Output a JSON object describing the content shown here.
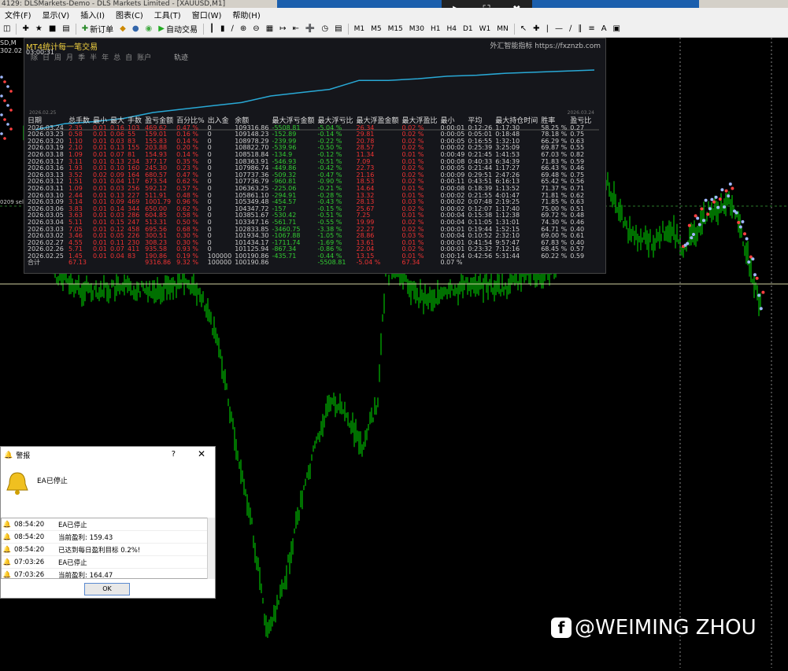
{
  "window": {
    "title": "4129: DLSMarkets-Demo - DLS Markets Limited - [XAUUSD,M1]"
  },
  "remote_control": {
    "icons": [
      "play-icon",
      "fullscreen-icon",
      "close-icon"
    ]
  },
  "menu": {
    "items": [
      "文件(F)",
      "显示(V)",
      "插入(I)",
      "图表(C)",
      "工具(T)",
      "窗口(W)",
      "帮助(H)"
    ]
  },
  "toolbar": {
    "new_order_label": "新订单",
    "auto_trade_label": "自动交易",
    "timeframes": [
      "M1",
      "M5",
      "M15",
      "M30",
      "H1",
      "H4",
      "D1",
      "W1",
      "MN"
    ]
  },
  "chart": {
    "symbol_label": "SD,M",
    "symbol_price": "302.02",
    "price_line_label": "0209 sell",
    "colors": {
      "candle": "#00e000",
      "background": "#000000",
      "price_line": "#d0d0a0"
    }
  },
  "panel": {
    "title": "MT4统计每一笔交易",
    "time": "03:00:31",
    "site": "外汇智能指标 https://fxznzb.com",
    "tabs": [
      "除",
      "日",
      "周",
      "月",
      "季",
      "半",
      "年",
      "总",
      "自",
      "账户"
    ],
    "curve_label": "轨迹",
    "curve_start_date": "2026.02.25",
    "curve_end_date": "2026.03.24",
    "headers": [
      "日期",
      "总手数",
      "最小",
      "最大",
      "手数",
      "盈亏金额",
      "百分比%",
      "出入金",
      "余额",
      "最大浮亏金额",
      "最大浮亏比",
      "最大浮盈金额",
      "最大浮盈比",
      "最小",
      "平均",
      "最大持仓时间",
      "胜率",
      "盈亏比"
    ],
    "rows": [
      [
        "2026.03.24",
        "2.35",
        "0.01",
        "0.16",
        "103",
        "469.62",
        "0.47 %",
        "0",
        "109316.86",
        "-5508.81",
        "-5.04 %",
        "26.34",
        "0.02 %",
        "0:00:01",
        "0:12:26",
        "1:17:30",
        "58.25 %",
        "0.27"
      ],
      [
        "2026.03.23",
        "0.58",
        "0.01",
        "0.06",
        "55",
        "159.01",
        "0.16 %",
        "0",
        "109148.23",
        "-152.89",
        "-0.14 %",
        "29.81",
        "0.02 %",
        "0:00:05",
        "0:05:01",
        "0:18:48",
        "78.18 %",
        "0.75"
      ],
      [
        "2026.03.20",
        "1.10",
        "0.01",
        "0.03",
        "83",
        "155.83",
        "0.14 %",
        "0",
        "108978.29",
        "-239.99",
        "-0.22 %",
        "20.78",
        "0.02 %",
        "0:00:05",
        "0:16:55",
        "1:32:10",
        "66.29 %",
        "0.63"
      ],
      [
        "2026.03.19",
        "2.10",
        "0.01",
        "0.13",
        "155",
        "203.88",
        "0.20 %",
        "0",
        "108822.70",
        "-539.96",
        "-0.50 %",
        "28.57",
        "0.02 %",
        "0:00:02",
        "0:25:39",
        "3:25:09",
        "69.87 %",
        "0.55"
      ],
      [
        "2026.03.18",
        "1.09",
        "0.01",
        "0.07",
        "81",
        "154.93",
        "0.14 %",
        "0",
        "108518.84",
        "-134.9",
        "-0.12 %",
        "11.34",
        "0.01 %",
        "0:00:49",
        "0:21:45",
        "1:41:53",
        "67.03 %",
        "0.82"
      ],
      [
        "2026.03.17",
        "3.11",
        "0.01",
        "0.13",
        "234",
        "377.17",
        "0.35 %",
        "0",
        "108363.91",
        "-546.93",
        "-0.51 %",
        "7.09",
        "0.01 %",
        "0:00:08",
        "0:40:33",
        "6:34:39",
        "71.83 %",
        "0.59"
      ],
      [
        "2026.03.16",
        "1.93",
        "0.01",
        "0.10",
        "160",
        "245.30",
        "0.23 %",
        "0",
        "107986.74",
        "-449.86",
        "-0.42 %",
        "22.73",
        "0.02 %",
        "0:00:05",
        "0:21:44",
        "1:17:27",
        "66.43 %",
        "0.46"
      ],
      [
        "2026.03.13",
        "3.52",
        "0.02",
        "0.09",
        "164",
        "680.57",
        "0.47 %",
        "0",
        "107737.36",
        "-509.32",
        "-0.47 %",
        "21.16",
        "0.02 %",
        "0:00:09",
        "0:29:51",
        "2:47:26",
        "69.48 %",
        "0.75"
      ],
      [
        "2026.03.12",
        "1.51",
        "0.01",
        "0.04",
        "117",
        "673.54",
        "0.62 %",
        "0",
        "107736.79",
        "-960.81",
        "-0.90 %",
        "18.53",
        "0.02 %",
        "0:00:11",
        "0:43:51",
        "6:16:13",
        "65.42 %",
        "0.56"
      ],
      [
        "2026.03.11",
        "1.09",
        "0.01",
        "0.03",
        "256",
        "592.12",
        "0.57 %",
        "0",
        "106363.25",
        "-225.06",
        "-0.21 %",
        "14.64",
        "0.01 %",
        "0:00:08",
        "0:18:39",
        "1:13:52",
        "71.37 %",
        "0.71"
      ],
      [
        "2026.03.10",
        "2.44",
        "0.01",
        "0.13",
        "227",
        "511.91",
        "0.48 %",
        "0",
        "105861.10",
        "-294.91",
        "-0.28 %",
        "13.32",
        "0.01 %",
        "0:00:02",
        "0:21:55",
        "4:01:47",
        "71.81 %",
        "0.62"
      ],
      [
        "2026.03.09",
        "3.14",
        "0.01",
        "0.09",
        "469",
        "1001.79",
        "0.96 %",
        "0",
        "105349.48",
        "-454.57",
        "-0.43 %",
        "28.13",
        "0.03 %",
        "0:00:02",
        "0:07:48",
        "2:19:25",
        "71.85 %",
        "0.63"
      ],
      [
        "2026.03.06",
        "3.83",
        "0.01",
        "0.14",
        "344",
        "650.00",
        "0.62 %",
        "0",
        "104347.72",
        "-157",
        "-0.15 %",
        "25.67",
        "0.02 %",
        "0:00:02",
        "0:12:07",
        "1:17:40",
        "75.00 %",
        "0.51"
      ],
      [
        "2026.03.05",
        "3.63",
        "0.01",
        "0.03",
        "286",
        "604.85",
        "0.58 %",
        "0",
        "103851.67",
        "-530.42",
        "-0.51 %",
        "7.25",
        "0.01 %",
        "0:00:04",
        "0:15:38",
        "1:12:38",
        "69.72 %",
        "0.48"
      ],
      [
        "2026.03.04",
        "5.11",
        "0.01",
        "0.15",
        "247",
        "513.31",
        "0.50 %",
        "0",
        "103347.16",
        "-561.71",
        "-0.55 %",
        "19.99",
        "0.02 %",
        "0:00:04",
        "0:11:05",
        "1:31:01",
        "74.30 %",
        "0.46"
      ],
      [
        "2026.03.03",
        "7.05",
        "0.01",
        "0.12",
        "458",
        "695.56",
        "0.68 %",
        "0",
        "102833.85",
        "-3460.75",
        "-3.38 %",
        "22.27",
        "0.02 %",
        "0:00:01",
        "0:19:44",
        "1:52:15",
        "64.71 %",
        "0.40"
      ],
      [
        "2026.03.02",
        "3.46",
        "0.01",
        "0.05",
        "226",
        "300.51",
        "0.30 %",
        "0",
        "101934.30",
        "-1067.88",
        "-1.05 %",
        "28.86",
        "0.03 %",
        "0:00:04",
        "0:10:52",
        "2:32:10",
        "69.00 %",
        "0.61"
      ],
      [
        "2026.02.27",
        "4.55",
        "0.01",
        "0.11",
        "230",
        "308.23",
        "0.30 %",
        "0",
        "101434.17",
        "-1711.74",
        "-1.69 %",
        "13.61",
        "0.01 %",
        "0:00:01",
        "0:41:54",
        "9:57:47",
        "67.83 %",
        "0.40"
      ],
      [
        "2026.02.26",
        "5.71",
        "0.01",
        "0.07",
        "411",
        "935.58",
        "0.93 %",
        "0",
        "101125.94",
        "-867.34",
        "-0.86 %",
        "22.04",
        "0.02 %",
        "0:00:01",
        "0:23:32",
        "7:12:16",
        "68.45 %",
        "0.57"
      ],
      [
        "2026.02.25",
        "1.45",
        "0.01",
        "0.04",
        "83",
        "190.86",
        "0.19 %",
        "100000",
        "100190.86",
        "-435.71",
        "-0.44 %",
        "13.15",
        "0.01 %",
        "0:00:14",
        "0:42:56",
        "5:31:44",
        "60.22 %",
        "0.59"
      ]
    ],
    "total": [
      "合计",
      "67.13",
      "",
      "",
      "",
      "9316.86",
      "9.32 %",
      "100000",
      "100190.86",
      "",
      "-5508.81",
      "-5.04 %",
      "67.34",
      "0.07 %",
      "",
      "",
      "",
      "",
      ""
    ]
  },
  "dialog": {
    "title": "警报",
    "help": "?",
    "close": "✕",
    "message": "EA已停止",
    "entries": [
      {
        "time": "08:54:20",
        "msg": "EA已停止"
      },
      {
        "time": "08:54:20",
        "msg": "当前盈利: 159.43"
      },
      {
        "time": "08:54:20",
        "msg": "已达到每日盈利目标 0.2%!"
      },
      {
        "time": "07:03:26",
        "msg": "EA已停止"
      },
      {
        "time": "07:03:26",
        "msg": "当前盈利: 164.47"
      }
    ],
    "ok_label": "OK"
  },
  "watermark": {
    "text": "@WEIMING ZHOU"
  }
}
